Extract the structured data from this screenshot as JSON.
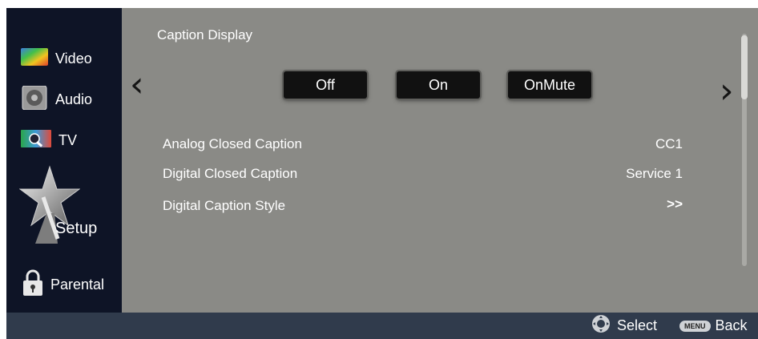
{
  "sidebar": {
    "items": [
      {
        "label": "Video",
        "icon": "video-icon"
      },
      {
        "label": "Audio",
        "icon": "audio-icon"
      },
      {
        "label": "TV",
        "icon": "tv-icon"
      },
      {
        "label": "Setup",
        "icon": "setup-star-icon"
      },
      {
        "label": "Parental",
        "icon": "lock-icon"
      }
    ]
  },
  "main": {
    "caption_display_label": "Caption Display",
    "prev_arrow": "‹",
    "next_arrow": "›",
    "options": [
      "Off",
      "On",
      "OnMute"
    ],
    "rows": [
      {
        "label": "Analog Closed Caption",
        "value": "CC1"
      },
      {
        "label": "Digital Closed Caption",
        "value": "Service 1"
      },
      {
        "label": "Digital Caption Style",
        "value": ">>"
      }
    ]
  },
  "footer": {
    "select_label": "Select",
    "menu_key": "MENU",
    "back_label": "Back"
  },
  "colors": {
    "sidebar_bg": "#0e1426",
    "main_bg": "#8a8a86",
    "footer_bg": "#303b4c",
    "button_bg": "#111111"
  }
}
